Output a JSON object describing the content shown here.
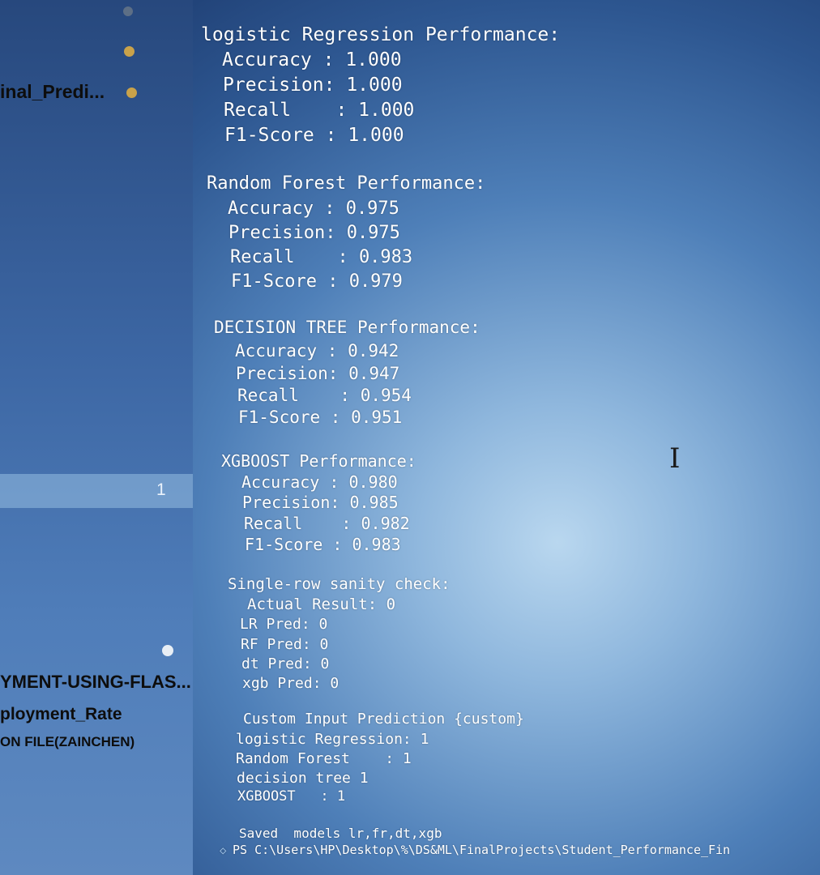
{
  "sidebar": {
    "file_item": "inal_Predi...",
    "badge_count": "1",
    "folders": [
      "YMENT-USING-FLAS...",
      "ployment_Rate",
      "ON FILE(ZAINCHEN)"
    ]
  },
  "terminal": {
    "lr": {
      "title": "logistic Regression Performance:",
      "accuracy": "Accuracy : 1.000",
      "precision": "Precision: 1.000",
      "recall": "Recall    : 1.000",
      "f1": "F1-Score : 1.000"
    },
    "rf": {
      "title": "Random Forest Performance:",
      "accuracy": "Accuracy : 0.975",
      "precision": "Precision: 0.975",
      "recall": "Recall    : 0.983",
      "f1": "F1-Score : 0.979"
    },
    "dt": {
      "title": "DECISION TREE Performance:",
      "accuracy": "Accuracy : 0.942",
      "precision": "Precision: 0.947",
      "recall": "Recall    : 0.954",
      "f1": "F1-Score : 0.951"
    },
    "xgb": {
      "title": "XGBOOST Performance:",
      "accuracy": "Accuracy : 0.980",
      "precision": "Precision: 0.985",
      "recall": "Recall    : 0.982",
      "f1": "F1-Score : 0.983"
    },
    "sanity": {
      "title": "Single-row sanity check:",
      "actual": "Actual Result: 0",
      "lr": "LR Pred: 0",
      "rf": "RF Pred: 0",
      "dt": "dt Pred: 0",
      "xgb": "xgb Pred: 0"
    },
    "custom": {
      "title": "Custom Input Prediction {custom}",
      "lr": "logistic Regression: 1",
      "rf": "Random Forest    : 1",
      "dt": "decision tree 1",
      "xgb": "XGBOOST   : 1"
    },
    "saved": "Saved  models lr,fr,dt,xgb",
    "prompt": "PS C:\\Users\\HP\\Desktop\\%\\DS&ML\\FinalProjects\\Student_Performance_Fin"
  },
  "colors": {
    "terminal_text": "#ffffff",
    "sidebar_text": "#0d0d0d",
    "dot_gold": "#c9a24a",
    "dot_white": "#e8eef5"
  }
}
